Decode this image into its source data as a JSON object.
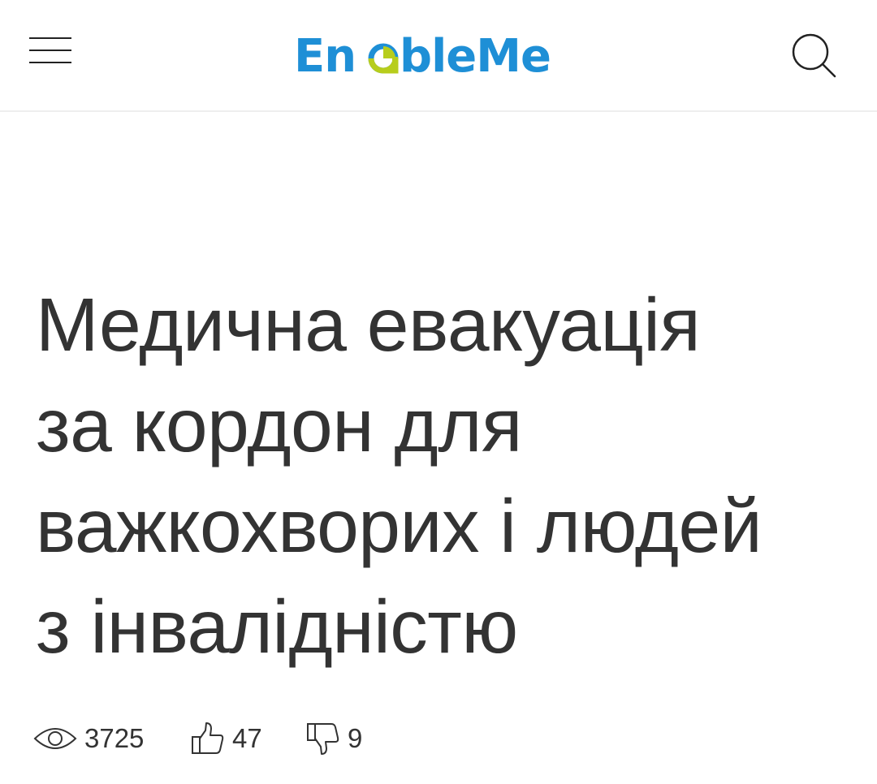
{
  "header": {
    "logo": {
      "text_before": "En",
      "text_after": "bleMe",
      "colors": {
        "blue": "#1e8fd6",
        "green": "#b7cd1c"
      }
    },
    "menu_icon": "hamburger-menu-icon",
    "search_icon": "search-icon"
  },
  "article": {
    "title_lines": [
      "Медична евакуація",
      "за кордон для",
      "важкохворих і людей",
      "з інвалідністю"
    ],
    "stats": {
      "views": "3725",
      "likes": "47",
      "dislikes": "9"
    }
  }
}
